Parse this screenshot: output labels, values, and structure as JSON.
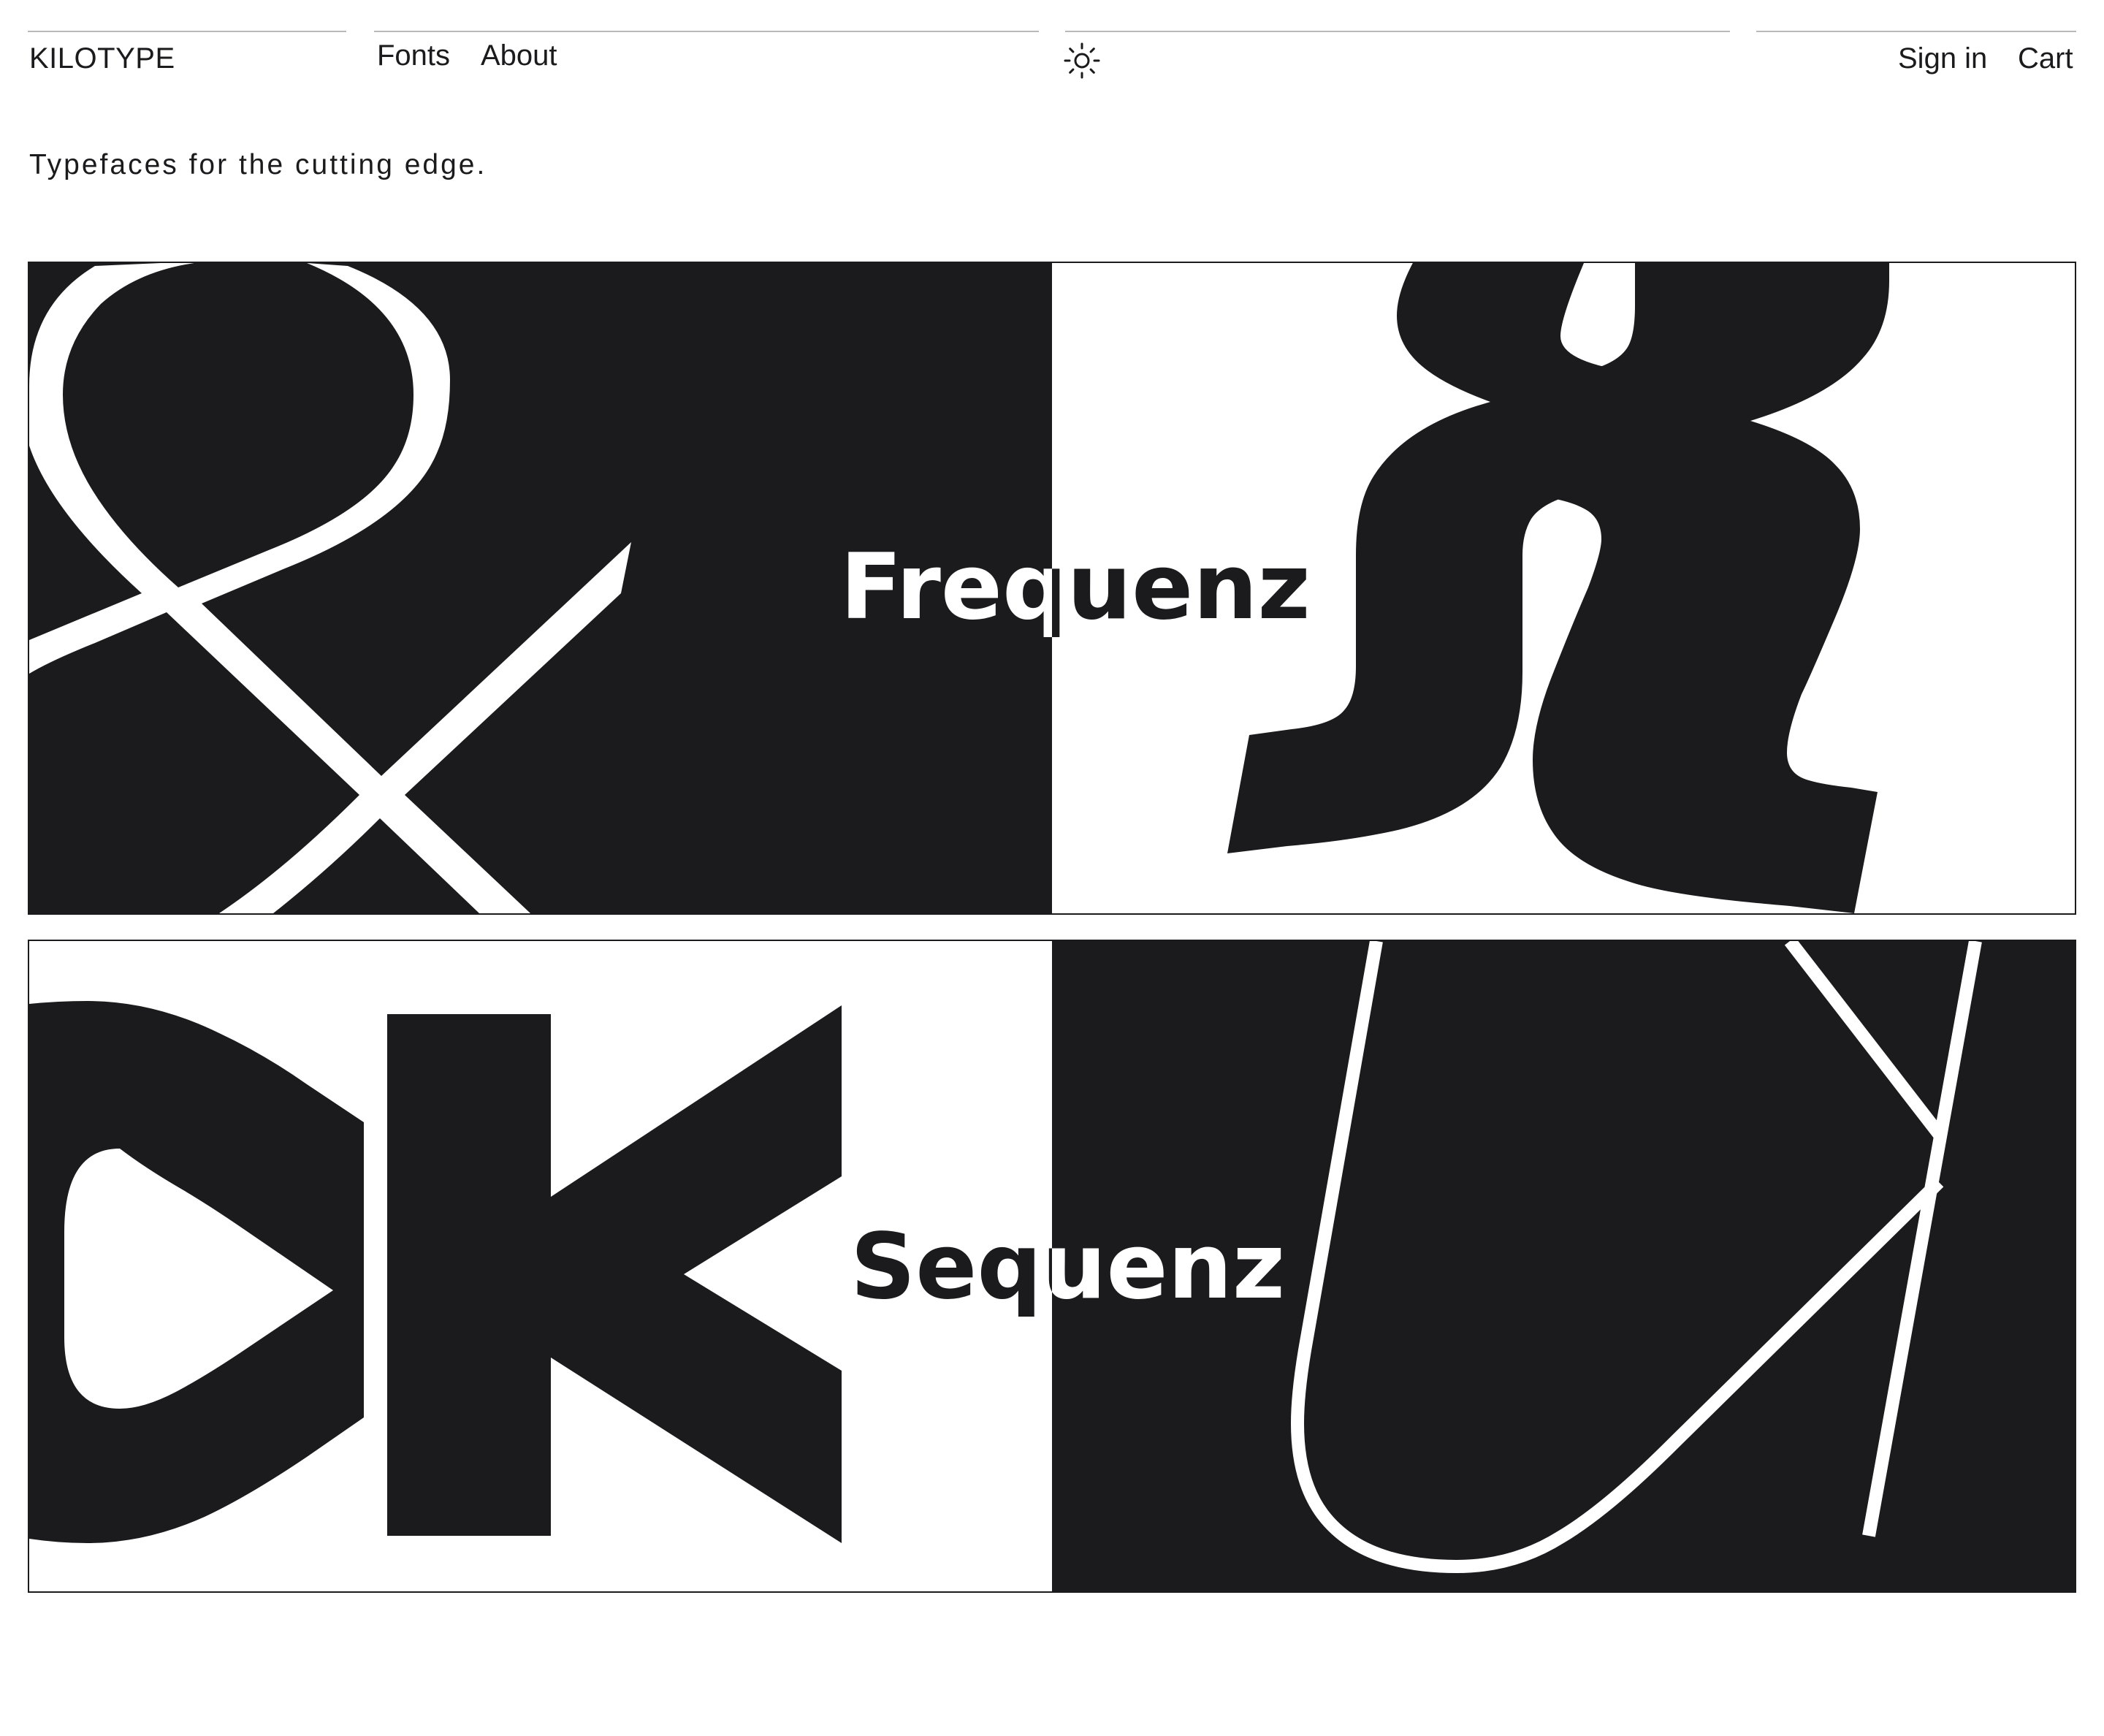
{
  "header": {
    "brand": "KILOTYPE",
    "nav": [
      {
        "label": "Fonts"
      },
      {
        "label": "About"
      }
    ],
    "theme_toggle_icon": "sun-icon",
    "account": {
      "sign_in": "Sign in",
      "cart": "Cart"
    }
  },
  "hero": {
    "tagline": "Typefaces for the cutting edge."
  },
  "fonts": [
    {
      "name": "Frequenz",
      "dark_side": "left",
      "glyph_icons": [
        "ampersand-glyph",
        "x-glyph"
      ]
    },
    {
      "name": "Sequenz",
      "dark_side": "right",
      "glyph_icons": [
        "ok-glyph",
        "uk-glyph"
      ]
    }
  ],
  "colors": {
    "ink": "#1b1b1d",
    "paper": "#ffffff",
    "rule": "#b9b9b9"
  }
}
